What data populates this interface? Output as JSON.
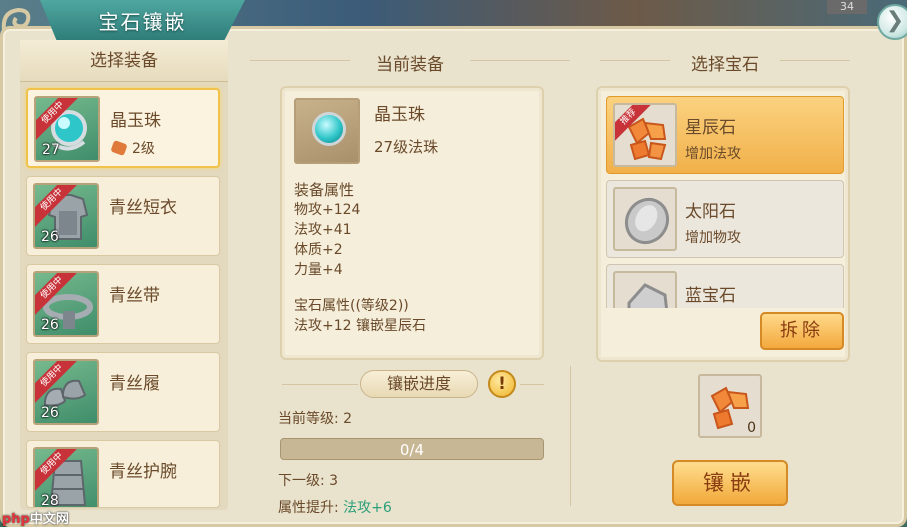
{
  "window": {
    "title": "宝石镶嵌",
    "close_glyph": "❯",
    "top_badge": "34"
  },
  "left": {
    "header": "选择装备",
    "items": [
      {
        "name": "晶玉珠",
        "level": "27",
        "badge": "使用中",
        "sub": "2级",
        "kind": "orb",
        "selected": true
      },
      {
        "name": "青丝短衣",
        "level": "26",
        "badge": "使用中",
        "sub": "",
        "kind": "armor"
      },
      {
        "name": "青丝带",
        "level": "26",
        "badge": "使用中",
        "sub": "",
        "kind": "belt"
      },
      {
        "name": "青丝履",
        "level": "26",
        "badge": "使用中",
        "sub": "",
        "kind": "shoes"
      },
      {
        "name": "青丝护腕",
        "level": "28",
        "badge": "使用中",
        "sub": "",
        "kind": "bracer"
      }
    ]
  },
  "middle": {
    "header": "当前装备",
    "item_name": "晶玉珠",
    "item_type": "27级法珠",
    "attr_header": "装备属性",
    "attrs": [
      "物攻+124",
      "法攻+41",
      "体质+2",
      "力量+4"
    ],
    "gem_header": "宝石属性((等级2))",
    "gem_line": "法攻+12 镶嵌星辰石",
    "progress_button": "镶嵌进度",
    "warn_glyph": "!",
    "current_level_label": "当前等级: 2",
    "progress_text": "0/4",
    "progress_fraction": 0,
    "next_level_label": "下一级: 3",
    "boost_label": "属性提升: ",
    "boost_value": "法攻+6"
  },
  "right": {
    "header": "选择宝石",
    "gems": [
      {
        "name": "星辰石",
        "desc": "增加法攻",
        "badge": "推荐",
        "color": "orange",
        "selected": true
      },
      {
        "name": "太阳石",
        "desc": "增加物攻",
        "color": "gray"
      },
      {
        "name": "蓝宝石",
        "desc": "",
        "color": "gray"
      }
    ],
    "remove_button": "拆除",
    "slot_count": "0",
    "inlay_button": "镶嵌"
  },
  "watermark": {
    "prefix": "php",
    "text": "中文网"
  }
}
